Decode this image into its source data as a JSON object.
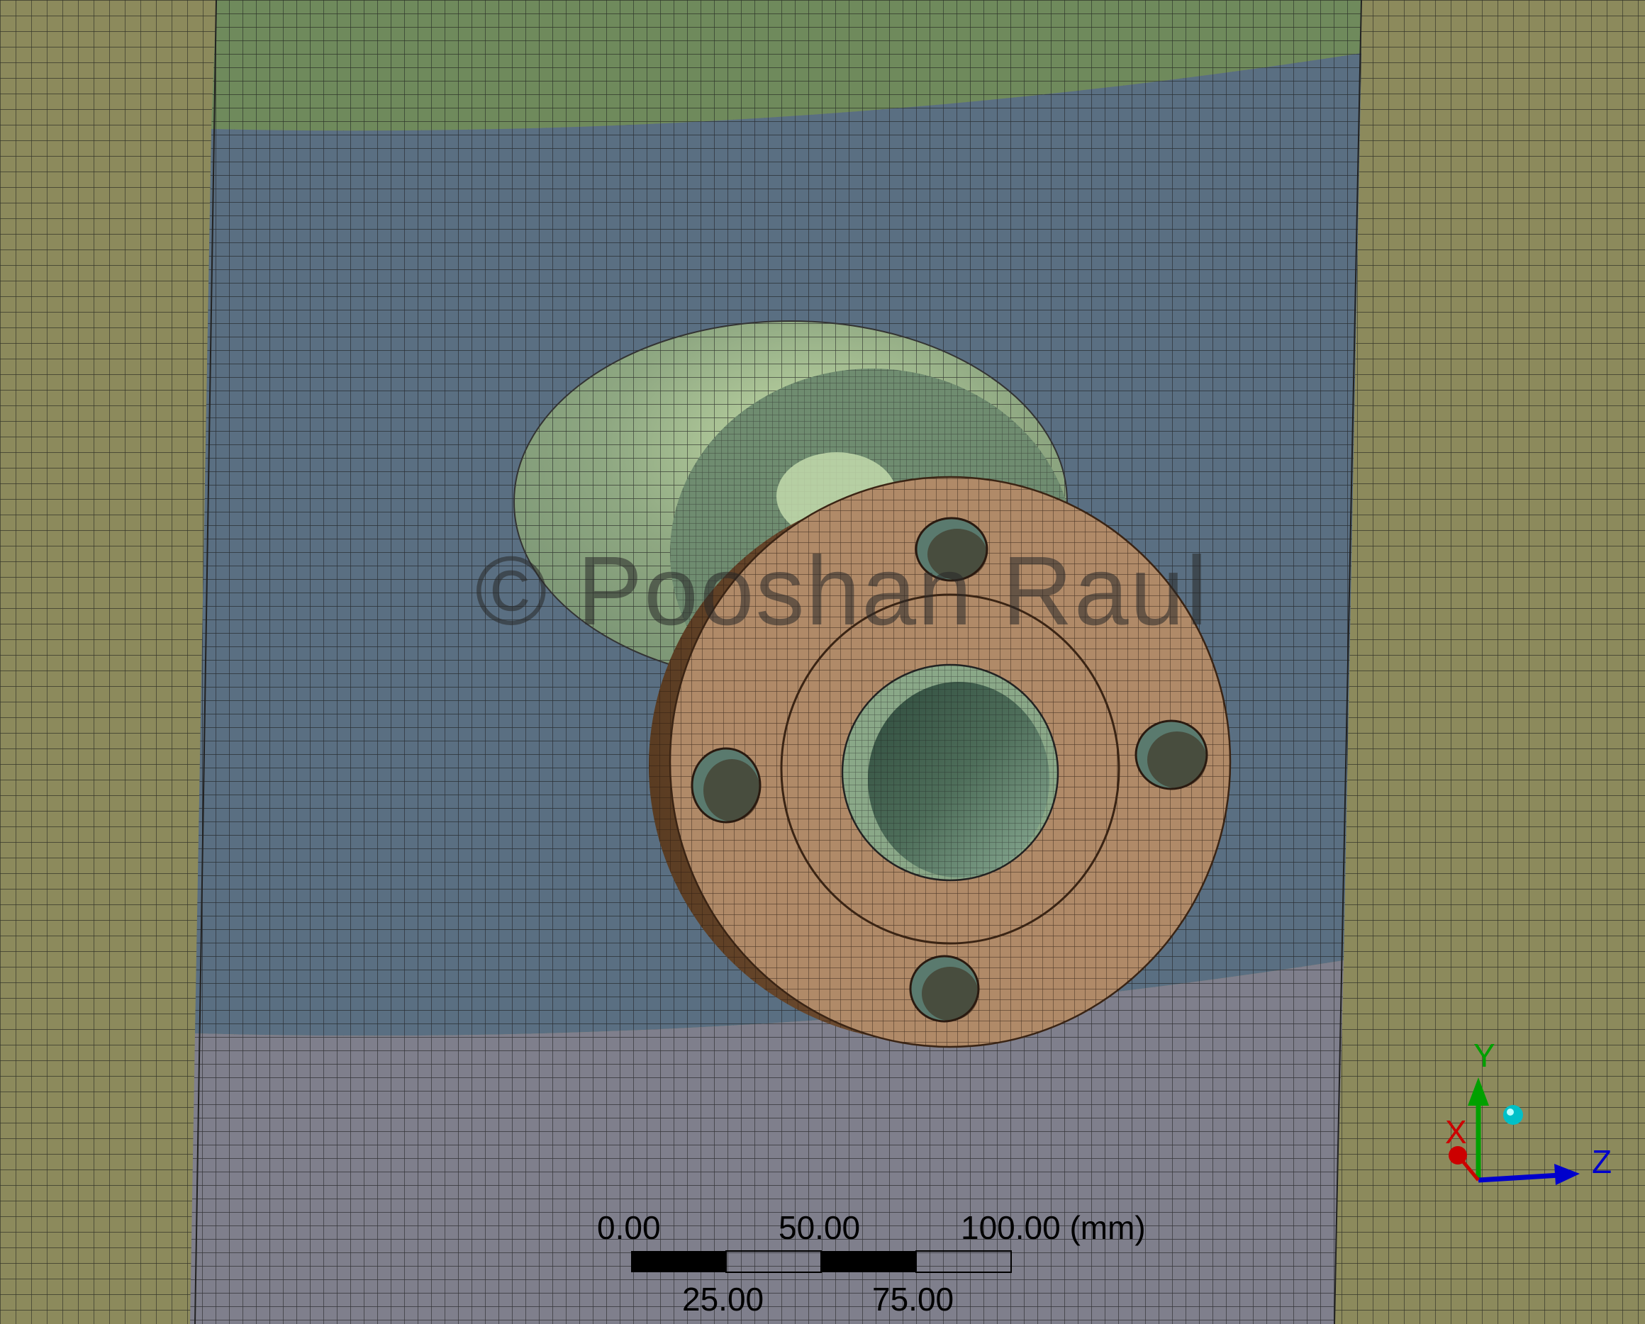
{
  "viewport": {
    "watermark": "© Pooshan Raul",
    "colors": {
      "outer_shell": "#8c8a5c",
      "band_top": "#6f8a5c",
      "band_middle": "#5a6f82",
      "band_bottom": "#7f7f8c",
      "nozzle_pad": "#8fa882",
      "flange": "#b08a68",
      "mesh_line": "#1a1a1a"
    }
  },
  "scale_bar": {
    "label_0": "0.00",
    "label_50": "50.00",
    "label_100": "100.00 (mm)",
    "label_25": "25.00",
    "label_75": "75.00"
  },
  "triad": {
    "x_label": "X",
    "y_label": "Y",
    "z_label": "Z",
    "x_color": "#cc0000",
    "y_color": "#00a000",
    "z_color": "#0000cc",
    "iso_color": "#00c0c8"
  }
}
